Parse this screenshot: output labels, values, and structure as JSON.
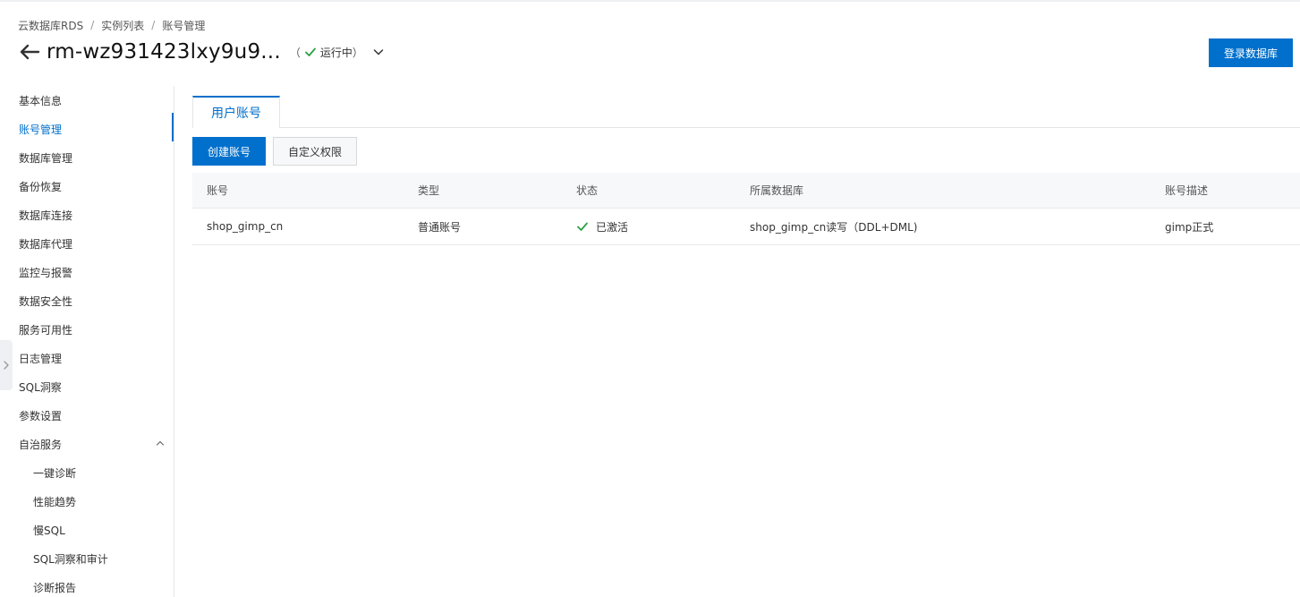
{
  "breadcrumb": [
    "云数据库RDS",
    "实例列表",
    "账号管理"
  ],
  "breadcrumb_separator": "/",
  "header": {
    "title": "rm-wz931423lxy9u9...",
    "status_open": "（",
    "status": "运行中",
    "status_close": "）",
    "login_button": "登录数据库"
  },
  "sidebar": {
    "items": [
      {
        "label": "基本信息"
      },
      {
        "label": "账号管理",
        "active": true
      },
      {
        "label": "数据库管理"
      },
      {
        "label": "备份恢复"
      },
      {
        "label": "数据库连接"
      },
      {
        "label": "数据库代理"
      },
      {
        "label": "监控与报警"
      },
      {
        "label": "数据安全性"
      },
      {
        "label": "服务可用性"
      },
      {
        "label": "日志管理"
      },
      {
        "label": "SQL洞察"
      },
      {
        "label": "参数设置"
      },
      {
        "label": "自治服务",
        "expanded": true
      },
      {
        "label": "一键诊断",
        "sub": true
      },
      {
        "label": "性能趋势",
        "sub": true
      },
      {
        "label": "慢SQL",
        "sub": true
      },
      {
        "label": "SQL洞察和审计",
        "sub": true
      },
      {
        "label": "诊断报告",
        "sub": true
      }
    ]
  },
  "tabs": [
    {
      "label": "用户账号",
      "active": true
    }
  ],
  "toolbar": {
    "create_label": "创建账号",
    "custom_perm_label": "自定义权限"
  },
  "table": {
    "columns": [
      "账号",
      "类型",
      "状态",
      "所属数据库",
      "账号描述"
    ],
    "rows": [
      {
        "account": "shop_gimp_cn",
        "type": "普通账号",
        "status": "已激活",
        "database": "shop_gimp_cn读写（DDL+DML)",
        "description": "gimp正式"
      }
    ]
  },
  "colors": {
    "accent": "#0070cc",
    "success": "#2aa146",
    "border": "#e3e5e8",
    "header_bg": "#f7f8fa"
  },
  "icons": {
    "back": "arrow-left-icon",
    "status": "check-icon",
    "dropdown": "chevron-down-icon",
    "expand": "chevron-up-icon",
    "collapse": "chevron-right-icon"
  }
}
